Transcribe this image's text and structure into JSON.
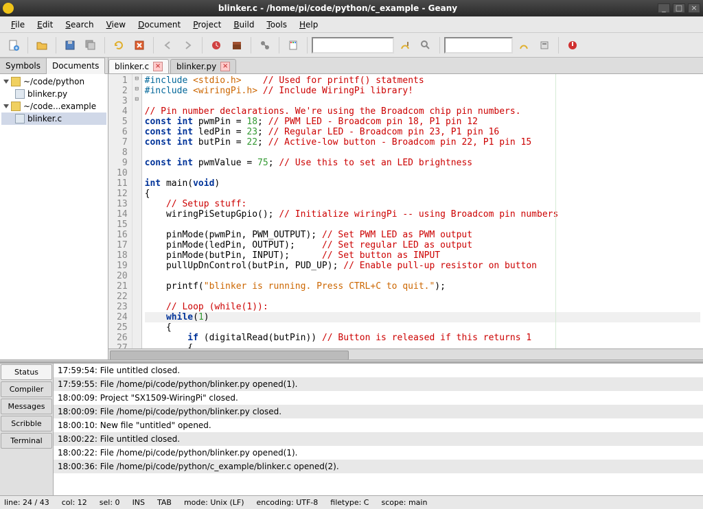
{
  "window": {
    "title": "blinker.c - /home/pi/code/python/c_example - Geany"
  },
  "menus": [
    "File",
    "Edit",
    "Search",
    "View",
    "Document",
    "Project",
    "Build",
    "Tools",
    "Help"
  ],
  "sidebar": {
    "tabs": [
      "Symbols",
      "Documents"
    ],
    "active_tab": "Documents",
    "tree": [
      {
        "label": "~/code/python",
        "type": "folder",
        "expanded": true,
        "children": [
          {
            "label": "blinker.py",
            "type": "file"
          }
        ]
      },
      {
        "label": "~/code...example",
        "type": "folder",
        "expanded": true,
        "children": [
          {
            "label": "blinker.c",
            "type": "file",
            "selected": true
          }
        ]
      }
    ]
  },
  "editor_tabs": [
    {
      "label": "blinker.c",
      "active": true
    },
    {
      "label": "blinker.py",
      "active": false
    }
  ],
  "code_lines": [
    {
      "n": 1,
      "f": "",
      "html": "<span class='pp'>#include</span> <span class='st'>&lt;stdio.h&gt;</span>    <span class='cm'>// Used for printf() statments</span>"
    },
    {
      "n": 2,
      "f": "",
      "html": "<span class='pp'>#include</span> <span class='st'>&lt;wiringPi.h&gt;</span> <span class='cm'>// Include WiringPi library!</span>"
    },
    {
      "n": 3,
      "f": "",
      "html": ""
    },
    {
      "n": 4,
      "f": "",
      "html": "<span class='cm'>// Pin number declarations. We're using the Broadcom chip pin numbers.</span>"
    },
    {
      "n": 5,
      "f": "",
      "html": "<span class='kw'>const</span> <span class='kw'>int</span> pwmPin = <span class='nu'>18</span>; <span class='cm'>// PWM LED - Broadcom pin 18, P1 pin 12</span>"
    },
    {
      "n": 6,
      "f": "",
      "html": "<span class='kw'>const</span> <span class='kw'>int</span> ledPin = <span class='nu'>23</span>; <span class='cm'>// Regular LED - Broadcom pin 23, P1 pin 16</span>"
    },
    {
      "n": 7,
      "f": "",
      "html": "<span class='kw'>const</span> <span class='kw'>int</span> butPin = <span class='nu'>22</span>; <span class='cm'>// Active-low button - Broadcom pin 22, P1 pin 15</span>"
    },
    {
      "n": 8,
      "f": "",
      "html": ""
    },
    {
      "n": 9,
      "f": "",
      "html": "<span class='kw'>const</span> <span class='kw'>int</span> pwmValue = <span class='nu'>75</span>; <span class='cm'>// Use this to set an LED brightness</span>"
    },
    {
      "n": 10,
      "f": "",
      "html": ""
    },
    {
      "n": 11,
      "f": "",
      "html": "<span class='kw'>int</span> main(<span class='kw'>void</span>)"
    },
    {
      "n": 12,
      "f": "⊟",
      "html": "{"
    },
    {
      "n": 13,
      "f": "",
      "html": "    <span class='cm'>// Setup stuff:</span>"
    },
    {
      "n": 14,
      "f": "",
      "html": "    wiringPiSetupGpio(); <span class='cm'>// Initialize wiringPi -- using Broadcom pin numbers</span>"
    },
    {
      "n": 15,
      "f": "",
      "html": ""
    },
    {
      "n": 16,
      "f": "",
      "html": "    pinMode(pwmPin, PWM_OUTPUT); <span class='cm'>// Set PWM LED as PWM output</span>"
    },
    {
      "n": 17,
      "f": "",
      "html": "    pinMode(ledPin, OUTPUT);     <span class='cm'>// Set regular LED as output</span>"
    },
    {
      "n": 18,
      "f": "",
      "html": "    pinMode(butPin, INPUT);      <span class='cm'>// Set button as INPUT</span>"
    },
    {
      "n": 19,
      "f": "",
      "html": "    pullUpDnControl(butPin, PUD_UP); <span class='cm'>// Enable pull-up resistor on button</span>"
    },
    {
      "n": 20,
      "f": "",
      "html": ""
    },
    {
      "n": 21,
      "f": "",
      "html": "    printf(<span class='st'>\"blinker is running. Press CTRL+C to quit.\"</span>);"
    },
    {
      "n": 22,
      "f": "",
      "html": ""
    },
    {
      "n": 23,
      "f": "",
      "html": "    <span class='cm'>// Loop (while(1)):</span>"
    },
    {
      "n": 24,
      "f": "",
      "cur": true,
      "html": "    <span class='kw'>while</span>(<span class='nu'>1</span>)"
    },
    {
      "n": 25,
      "f": "⊟",
      "html": "    {"
    },
    {
      "n": 26,
      "f": "",
      "html": "        <span class='kw'>if</span> (digitalRead(butPin)) <span class='cm'>// Button is released if this returns 1</span>"
    },
    {
      "n": 27,
      "f": "⊟",
      "html": "        {"
    }
  ],
  "bottom_tabs": [
    "Status",
    "Compiler",
    "Messages",
    "Scribble",
    "Terminal"
  ],
  "messages": [
    "17:59:54: File untitled closed.",
    "17:59:55: File /home/pi/code/python/blinker.py opened(1).",
    "18:00:09: Project \"SX1509-WiringPi\" closed.",
    "18:00:09: File /home/pi/code/python/blinker.py closed.",
    "18:00:10: New file \"untitled\" opened.",
    "18:00:22: File untitled closed.",
    "18:00:22: File /home/pi/code/python/blinker.py opened(1).",
    "18:00:36: File /home/pi/code/python/c_example/blinker.c opened(2)."
  ],
  "status": {
    "line": "line: 24 / 43",
    "col": "col: 12",
    "sel": "sel: 0",
    "ins": "INS",
    "tab": "TAB",
    "mode": "mode: Unix (LF)",
    "enc": "encoding: UTF-8",
    "ftype": "filetype: C",
    "scope": "scope: main"
  }
}
